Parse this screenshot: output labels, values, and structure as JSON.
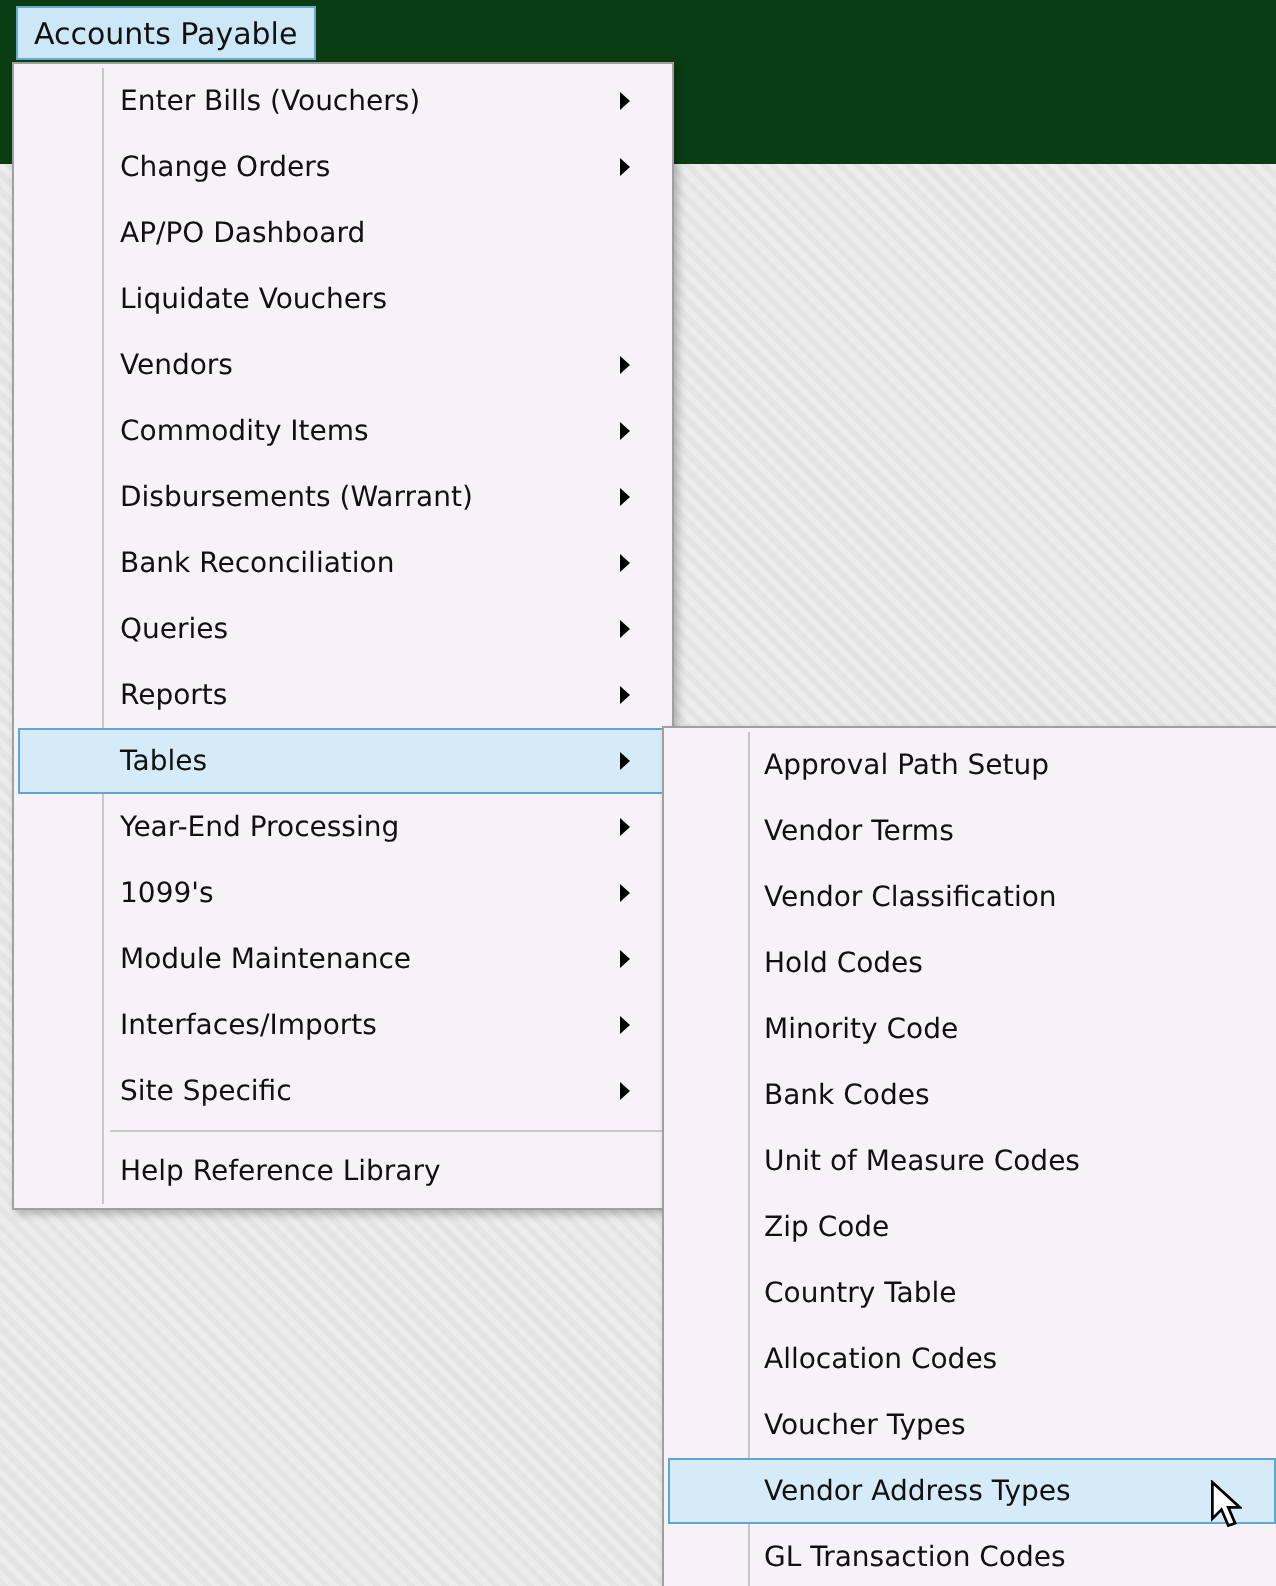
{
  "menu_bar": {
    "label": "Accounts Payable",
    "selected": true
  },
  "menu": [
    {
      "kind": "item",
      "label": "Enter Bills (Vouchers)",
      "submenu": true,
      "selected": false
    },
    {
      "kind": "item",
      "label": "Change Orders",
      "submenu": true,
      "selected": false
    },
    {
      "kind": "item",
      "label": "AP/PO Dashboard",
      "submenu": false,
      "selected": false
    },
    {
      "kind": "item",
      "label": "Liquidate Vouchers",
      "submenu": false,
      "selected": false
    },
    {
      "kind": "item",
      "label": "Vendors",
      "submenu": true,
      "selected": false
    },
    {
      "kind": "item",
      "label": "Commodity Items",
      "submenu": true,
      "selected": false
    },
    {
      "kind": "item",
      "label": "Disbursements (Warrant)",
      "submenu": true,
      "selected": false
    },
    {
      "kind": "item",
      "label": "Bank Reconciliation",
      "submenu": true,
      "selected": false
    },
    {
      "kind": "item",
      "label": "Queries",
      "submenu": true,
      "selected": false
    },
    {
      "kind": "item",
      "label": "Reports",
      "submenu": true,
      "selected": false
    },
    {
      "kind": "item",
      "label": "Tables",
      "submenu": true,
      "selected": true
    },
    {
      "kind": "item",
      "label": "Year-End Processing",
      "submenu": true,
      "selected": false
    },
    {
      "kind": "item",
      "label": "1099's",
      "submenu": true,
      "selected": false
    },
    {
      "kind": "item",
      "label": "Module Maintenance",
      "submenu": true,
      "selected": false
    },
    {
      "kind": "item",
      "label": "Interfaces/Imports",
      "submenu": true,
      "selected": false
    },
    {
      "kind": "item",
      "label": "Site Specific",
      "submenu": true,
      "selected": false
    },
    {
      "kind": "separator"
    },
    {
      "kind": "item",
      "label": "Help Reference Library",
      "submenu": false,
      "selected": false
    }
  ],
  "submenu": [
    {
      "label": "Approval Path Setup",
      "selected": false
    },
    {
      "label": "Vendor Terms",
      "selected": false
    },
    {
      "label": "Vendor Classification",
      "selected": false
    },
    {
      "label": "Hold Codes",
      "selected": false
    },
    {
      "label": "Minority Code",
      "selected": false
    },
    {
      "label": "Bank Codes",
      "selected": false
    },
    {
      "label": "Unit of Measure Codes",
      "selected": false
    },
    {
      "label": "Zip Code",
      "selected": false
    },
    {
      "label": "Country Table",
      "selected": false
    },
    {
      "label": "Allocation Codes",
      "selected": false
    },
    {
      "label": "Voucher Types",
      "selected": false
    },
    {
      "label": "Vendor Address Types",
      "selected": true
    },
    {
      "label": "GL Transaction Codes",
      "selected": false
    }
  ]
}
